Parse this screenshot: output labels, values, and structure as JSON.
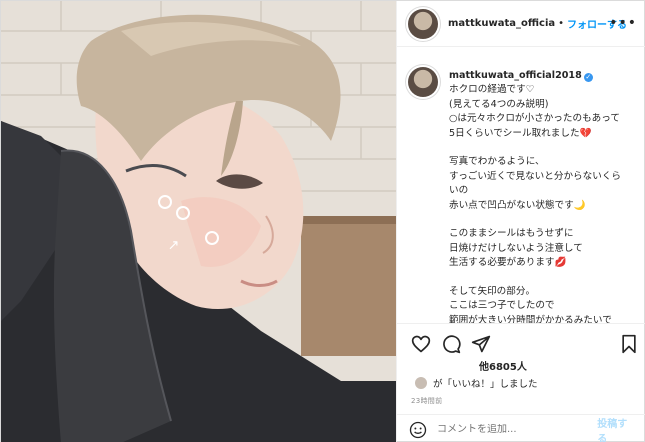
{
  "header": {
    "username": "mattkuwata_officia",
    "separator": "•",
    "follow_label": "フォローする",
    "more_icon": "more-horizontal-icon",
    "more_label": "•••"
  },
  "caption": {
    "username": "mattkuwata_official2018",
    "verified_label": "✓",
    "lines": [
      "ホクロの経過です♡",
      "(見えてる4つのみ説明)",
      "○は元々ホクロが小さかったのもあって",
      "5日くらいでシール取れました💔",
      "",
      "写真でわかるように、",
      "すっごい近くで見ないと分からないくら",
      "いの",
      "赤い点で凹凸がない状態です🌙",
      "",
      "このままシールはもうせずに",
      "日焼けだけしないよう注意して",
      "生活する必要があります💋",
      "",
      "そして矢印の部分。",
      "ここは三つ子でしたので",
      "範囲が大きい分時間がかかるみたいで"
    ]
  },
  "actions": {
    "icons": [
      "heart-icon",
      "comment-icon",
      "share-icon",
      "bookmark-icon"
    ],
    "likes_text": "他6805人",
    "liked_by_text": "が「いいね！」しました",
    "time_text": "23時間前"
  },
  "comment": {
    "placeholder": "コメントを追加...",
    "post_label": "投稿する"
  },
  "photo": {
    "annotation_marks": [
      "circle",
      "circle",
      "circle",
      "arrow"
    ],
    "arrow_glyph": "↑"
  }
}
